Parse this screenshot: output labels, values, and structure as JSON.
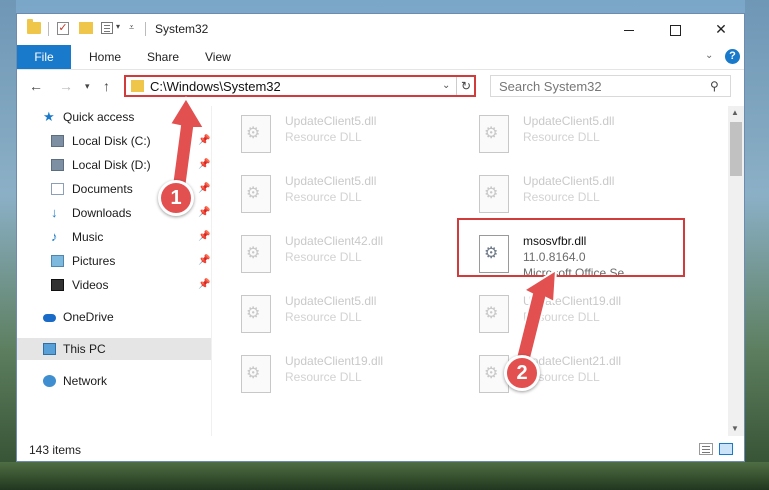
{
  "window": {
    "title": "System32",
    "controls": {
      "minimize": "",
      "maximize": "",
      "close": "✕"
    }
  },
  "ribbon": {
    "file": "File",
    "tabs": [
      "Home",
      "Share",
      "View"
    ],
    "help": "?"
  },
  "address_bar": {
    "path": "C:\\Windows\\System32",
    "search_placeholder": "Search System32"
  },
  "sidebar": {
    "items": [
      {
        "label": "Quick access",
        "icon": "star-icon",
        "pinned": false
      },
      {
        "label": "Local Disk (C:)",
        "icon": "drive-icon",
        "pinned": true
      },
      {
        "label": "Local Disk (D:)",
        "icon": "drive-icon",
        "pinned": true
      },
      {
        "label": "Documents",
        "icon": "documents-icon",
        "pinned": true
      },
      {
        "label": "Downloads",
        "icon": "download-icon",
        "pinned": true
      },
      {
        "label": "Music",
        "icon": "music-icon",
        "pinned": true
      },
      {
        "label": "Pictures",
        "icon": "pictures-icon",
        "pinned": true
      },
      {
        "label": "Videos",
        "icon": "videos-icon",
        "pinned": true
      },
      {
        "label": "OneDrive",
        "icon": "cloud-icon",
        "pinned": false
      },
      {
        "label": "This PC",
        "icon": "computer-icon",
        "pinned": false,
        "selected": true
      },
      {
        "label": "Network",
        "icon": "network-icon",
        "pinned": false
      }
    ]
  },
  "files": [
    {
      "name": "UpdateClient5.dll",
      "desc": "Resource DLL"
    },
    {
      "name": "UpdateClient5.dll",
      "desc": "Resource DLL"
    },
    {
      "name": "UpdateClient5.dll",
      "desc": "Resource DLL"
    },
    {
      "name": "UpdateClient5.dll",
      "desc": "Resource DLL"
    },
    {
      "name": "UpdateClient42.dll",
      "desc": "Resource DLL"
    },
    {
      "name": "msosvfbr.dll",
      "version": "11.0.8164.0",
      "desc": "Microsoft Office Se...",
      "active": true
    },
    {
      "name": "UpdateClient5.dll",
      "desc": "Resource DLL"
    },
    {
      "name": "UpdateClient19.dll",
      "desc": "Resource DLL"
    },
    {
      "name": "UpdateClient19.dll",
      "desc": "Resource DLL"
    },
    {
      "name": "UpdateClient21.dll",
      "desc": "Resource DLL"
    }
  ],
  "status": {
    "item_count": "143 items"
  },
  "annotations": {
    "step1": "1",
    "step2": "2",
    "color": "#e25050"
  }
}
